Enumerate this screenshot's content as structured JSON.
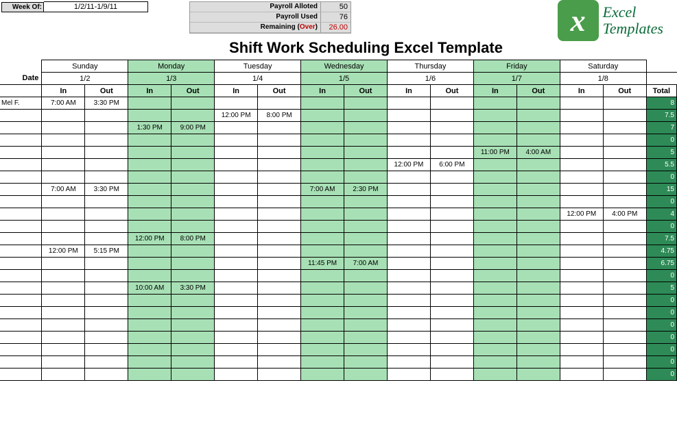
{
  "header": {
    "week_label": "Week Of:",
    "week_value": "1/2/11-1/9/11",
    "payroll": [
      {
        "label": "Payroll Alloted",
        "value": "50",
        "label_class": "",
        "value_class": ""
      },
      {
        "label": "Payroll Used",
        "value": "76",
        "label_class": "",
        "value_class": ""
      },
      {
        "label": "Remaining (",
        "over": "Over",
        "label_close": ")",
        "value": "26.00",
        "label_class": "",
        "value_class": "red"
      }
    ]
  },
  "logo": {
    "brand1": "Excel",
    "brand2": "Templates",
    "mark": "x"
  },
  "title": "Shift Work Scheduling Excel Template",
  "days": [
    "Sunday",
    "Monday",
    "Tuesday",
    "Wednesday",
    "Thursday",
    "Friday",
    "Saturday"
  ],
  "date_label": "Date",
  "dates": [
    "1/2",
    "1/3",
    "1/4",
    "1/5",
    "1/6",
    "1/7",
    "1/8"
  ],
  "inout": {
    "in": "In",
    "out": "Out"
  },
  "total_label": "Total",
  "rows": [
    {
      "name": "Mel F.",
      "cells": [
        "7:00 AM",
        "3:30 PM",
        "",
        "",
        "",
        "",
        "",
        "",
        "",
        "",
        "",
        "",
        "",
        ""
      ],
      "total": "8"
    },
    {
      "name": "",
      "cells": [
        "",
        "",
        "",
        "",
        "12:00 PM",
        "8:00 PM",
        "",
        "",
        "",
        "",
        "",
        "",
        "",
        ""
      ],
      "total": "7.5"
    },
    {
      "name": "",
      "cells": [
        "",
        "",
        "1:30 PM",
        "9:00 PM",
        "",
        "",
        "",
        "",
        "",
        "",
        "",
        "",
        "",
        ""
      ],
      "total": "7"
    },
    {
      "name": "",
      "cells": [
        "",
        "",
        "",
        "",
        "",
        "",
        "",
        "",
        "",
        "",
        "",
        "",
        "",
        ""
      ],
      "total": "0"
    },
    {
      "name": "",
      "cells": [
        "",
        "",
        "",
        "",
        "",
        "",
        "",
        "",
        "",
        "",
        "11:00 PM",
        "4:00 AM",
        "",
        ""
      ],
      "total": "5"
    },
    {
      "name": "",
      "cells": [
        "",
        "",
        "",
        "",
        "",
        "",
        "",
        "",
        "12:00 PM",
        "6:00 PM",
        "",
        "",
        "",
        ""
      ],
      "total": "5.5"
    },
    {
      "name": "",
      "cells": [
        "",
        "",
        "",
        "",
        "",
        "",
        "",
        "",
        "",
        "",
        "",
        "",
        "",
        ""
      ],
      "total": "0"
    },
    {
      "name": "",
      "cells": [
        "7:00 AM",
        "3:30 PM",
        "",
        "",
        "",
        "",
        "7:00 AM",
        "2:30 PM",
        "",
        "",
        "",
        "",
        "",
        ""
      ],
      "total": "15"
    },
    {
      "name": "",
      "cells": [
        "",
        "",
        "",
        "",
        "",
        "",
        "",
        "",
        "",
        "",
        "",
        "",
        "",
        ""
      ],
      "total": "0"
    },
    {
      "name": "",
      "cells": [
        "",
        "",
        "",
        "",
        "",
        "",
        "",
        "",
        "",
        "",
        "",
        "",
        "12:00 PM",
        "4:00 PM"
      ],
      "total": "4"
    },
    {
      "name": "",
      "cells": [
        "",
        "",
        "",
        "",
        "",
        "",
        "",
        "",
        "",
        "",
        "",
        "",
        "",
        ""
      ],
      "total": "0"
    },
    {
      "name": "",
      "cells": [
        "",
        "",
        "12:00 PM",
        "8:00 PM",
        "",
        "",
        "",
        "",
        "",
        "",
        "",
        "",
        "",
        ""
      ],
      "total": "7.5"
    },
    {
      "name": "",
      "cells": [
        "12:00 PM",
        "5:15 PM",
        "",
        "",
        "",
        "",
        "",
        "",
        "",
        "",
        "",
        "",
        "",
        ""
      ],
      "total": "4.75"
    },
    {
      "name": "",
      "cells": [
        "",
        "",
        "",
        "",
        "",
        "",
        "11:45 PM",
        "7:00 AM",
        "",
        "",
        "",
        "",
        "",
        ""
      ],
      "total": "6.75"
    },
    {
      "name": "",
      "cells": [
        "",
        "",
        "",
        "",
        "",
        "",
        "",
        "",
        "",
        "",
        "",
        "",
        "",
        ""
      ],
      "total": "0"
    },
    {
      "name": "",
      "cells": [
        "",
        "",
        "10:00 AM",
        "3:30 PM",
        "",
        "",
        "",
        "",
        "",
        "",
        "",
        "",
        "",
        ""
      ],
      "total": "5"
    },
    {
      "name": "",
      "cells": [
        "",
        "",
        "",
        "",
        "",
        "",
        "",
        "",
        "",
        "",
        "",
        "",
        "",
        ""
      ],
      "total": "0"
    },
    {
      "name": "",
      "cells": [
        "",
        "",
        "",
        "",
        "",
        "",
        "",
        "",
        "",
        "",
        "",
        "",
        "",
        ""
      ],
      "total": "0"
    },
    {
      "name": "",
      "cells": [
        "",
        "",
        "",
        "",
        "",
        "",
        "",
        "",
        "",
        "",
        "",
        "",
        "",
        ""
      ],
      "total": "0"
    },
    {
      "name": "",
      "cells": [
        "",
        "",
        "",
        "",
        "",
        "",
        "",
        "",
        "",
        "",
        "",
        "",
        "",
        ""
      ],
      "total": "0"
    },
    {
      "name": "",
      "cells": [
        "",
        "",
        "",
        "",
        "",
        "",
        "",
        "",
        "",
        "",
        "",
        "",
        "",
        ""
      ],
      "total": "0"
    },
    {
      "name": "",
      "cells": [
        "",
        "",
        "",
        "",
        "",
        "",
        "",
        "",
        "",
        "",
        "",
        "",
        "",
        ""
      ],
      "total": "0"
    },
    {
      "name": "",
      "cells": [
        "",
        "",
        "",
        "",
        "",
        "",
        "",
        "",
        "",
        "",
        "",
        "",
        "",
        ""
      ],
      "total": "0"
    }
  ],
  "alt_day_index": [
    1,
    3,
    5
  ]
}
